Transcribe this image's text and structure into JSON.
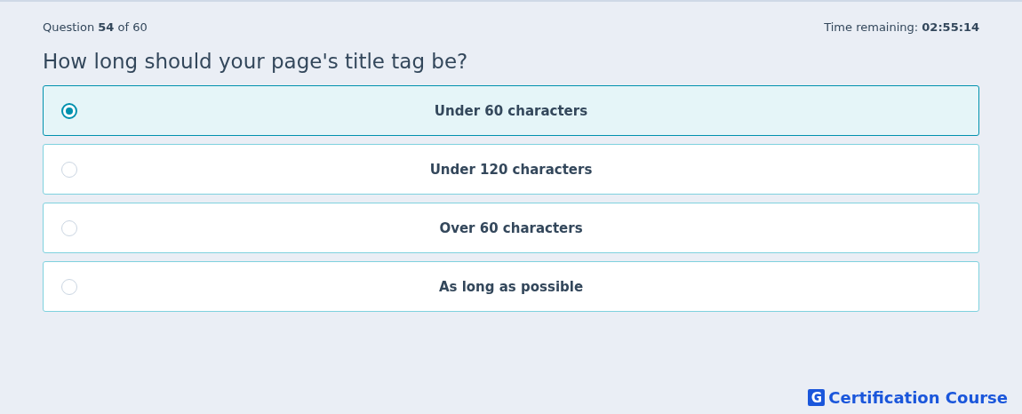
{
  "header": {
    "progress": "Question **54** of 60",
    "timer": "Time remaining: **02:55:14**"
  },
  "question": "How long should your page's title tag be?",
  "options": [
    {
      "label": "Under 60 characters",
      "selected": true
    },
    {
      "label": "Under 120 characters",
      "selected": false
    },
    {
      "label": "Over 60 characters",
      "selected": false
    },
    {
      "label": "As long as possible",
      "selected": false
    }
  ],
  "footer": {
    "logo_mark": "G",
    "logo_text": "Certification Course"
  }
}
